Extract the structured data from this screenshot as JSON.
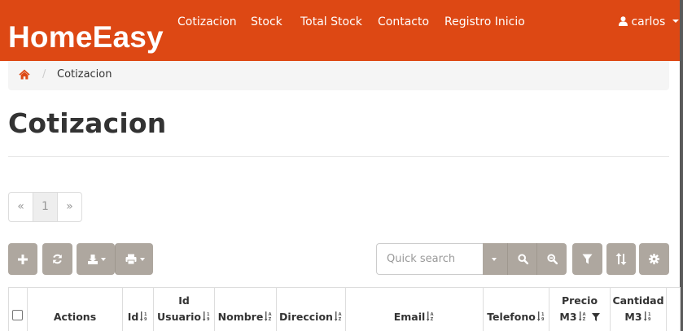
{
  "app": {
    "brand": "HomeEasy"
  },
  "nav": {
    "links": [
      "Cotizacion",
      "Stock",
      "Total Stock",
      "Contacto",
      "Registro Inicio"
    ],
    "user": "carlos"
  },
  "breadcrumb": {
    "current": "Cotizacion"
  },
  "page": {
    "title": "Cotizacion"
  },
  "pager": {
    "prev": "«",
    "current": "1",
    "next": "»"
  },
  "toolbar": {
    "search_placeholder": "Quick search",
    "accent_color": "#dd4814",
    "button_color": "#aea79f"
  },
  "table": {
    "headers": {
      "actions": "Actions",
      "id": "Id",
      "id_usuario_1": "Id",
      "id_usuario_2": "Usuario",
      "nombre": "Nombre",
      "direccion": "Direccion",
      "email": "Email",
      "telefono": "Telefono",
      "precio_1": "Precio",
      "precio_2": "M3",
      "cantidad_1": "Cantidad",
      "cantidad_2": "M3"
    }
  }
}
